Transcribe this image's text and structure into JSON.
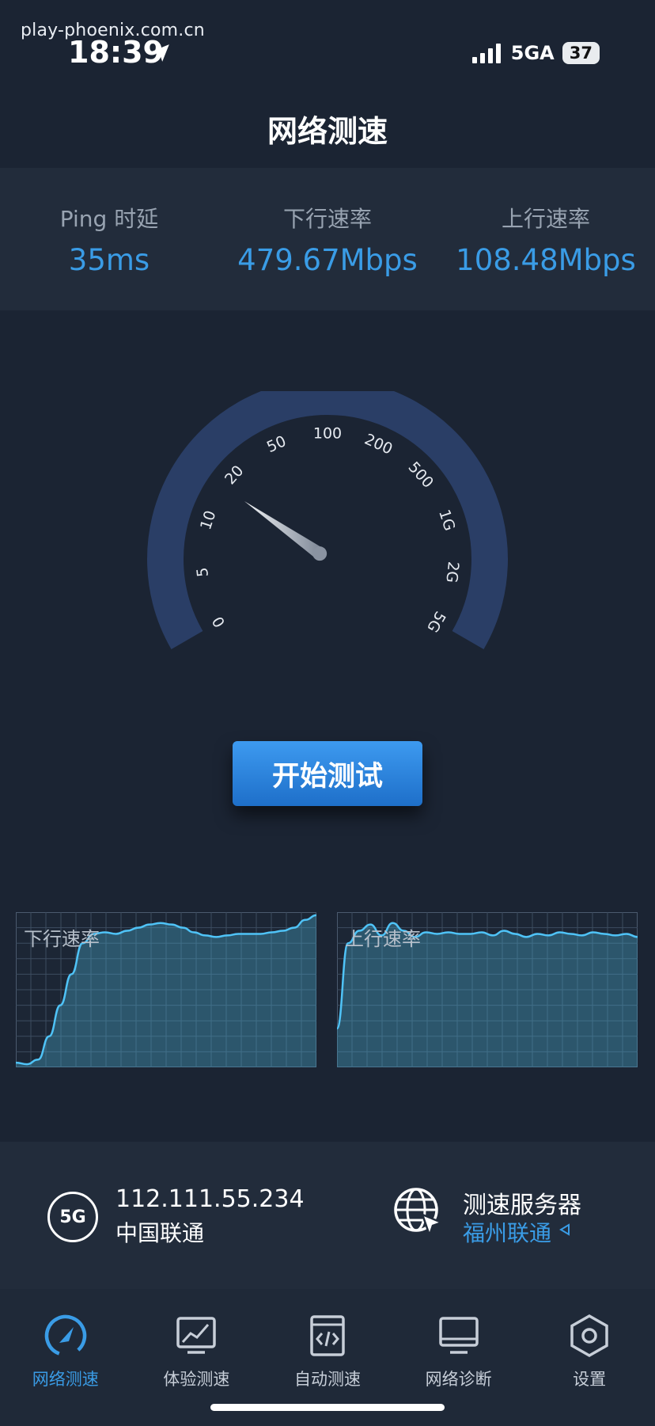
{
  "status_bar": {
    "watermark": "play-phoenix.com.cn",
    "time": "18:39",
    "network": "5GA",
    "battery": "37"
  },
  "title": "网络测速",
  "stats": {
    "ping_label": "Ping 时延",
    "ping_value": "35ms",
    "download_label": "下行速率",
    "download_value": "479.67Mbps",
    "upload_label": "上行速率",
    "upload_value": "108.48Mbps"
  },
  "gauge": {
    "ticks": [
      "0",
      "5",
      "10",
      "20",
      "50",
      "100",
      "200",
      "500",
      "1G",
      "2G",
      "5G"
    ],
    "needle_fraction": 0.27
  },
  "start_button": "开始测试",
  "charts": {
    "download_label": "下行速率",
    "download_series": [
      0.03,
      0.02,
      0.05,
      0.2,
      0.4,
      0.6,
      0.8,
      0.86,
      0.87,
      0.86,
      0.88,
      0.9,
      0.92,
      0.93,
      0.92,
      0.9,
      0.87,
      0.85,
      0.84,
      0.85,
      0.86,
      0.86,
      0.86,
      0.87,
      0.88,
      0.9,
      0.95,
      0.98
    ],
    "upload_label": "上行速率",
    "upload_series": [
      0.25,
      0.8,
      0.88,
      0.92,
      0.85,
      0.93,
      0.88,
      0.84,
      0.87,
      0.86,
      0.87,
      0.86,
      0.86,
      0.87,
      0.85,
      0.88,
      0.86,
      0.84,
      0.86,
      0.85,
      0.87,
      0.86,
      0.85,
      0.87,
      0.86,
      0.85,
      0.86,
      0.84
    ]
  },
  "info": {
    "network_badge": "5G",
    "ip": "112.111.55.234",
    "carrier": "中国联通",
    "server_label": "测速服务器",
    "server_value": "福州联通"
  },
  "tabs": [
    {
      "label": "网络测速",
      "icon": "speedometer-icon"
    },
    {
      "label": "体验测速",
      "icon": "chart-monitor-icon"
    },
    {
      "label": "自动测速",
      "icon": "code-doc-icon"
    },
    {
      "label": "网络诊断",
      "icon": "monitor-icon"
    },
    {
      "label": "设置",
      "icon": "hexagon-gear-icon"
    }
  ],
  "colors": {
    "background": "#1b2433",
    "panel": "#222c3b",
    "accent": "#3a9ce6",
    "gauge_track": "#2a3e66",
    "chart_line": "#4fc3f7"
  }
}
